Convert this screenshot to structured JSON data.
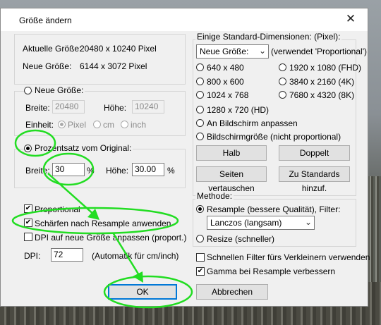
{
  "window": {
    "title": "Größe ändern",
    "close_symbol": "✕"
  },
  "info": {
    "current_label": "Aktuelle Größe:",
    "current_value": "20480  x  10240  Pixel",
    "new_label": "Neue Größe:",
    "new_value": "6144  x  3072  Pixel"
  },
  "new_size": {
    "radio_label": "Neue Größe:",
    "width_label": "Breite:",
    "width_value": "20480",
    "height_label": "Höhe:",
    "height_value": "10240",
    "unit_label": "Einheit:",
    "unit_pixel": "Pixel",
    "unit_cm": "cm",
    "unit_inch": "inch"
  },
  "percent": {
    "radio_label": "Prozentsatz vom Original:",
    "width_label": "Breite:",
    "width_value": "30",
    "width_unit": "%",
    "height_label": "Höhe:",
    "height_value": "30.00",
    "height_unit": "%"
  },
  "options": {
    "proportional": "Proportional",
    "sharpen": "Schärfen nach Resample anwenden",
    "dpi_apply": "DPI auf neue Größe anpassen (proport.)",
    "dpi_label": "DPI:",
    "dpi_value": "72",
    "dpi_note": "(Automatik für cm/inch)"
  },
  "buttons": {
    "ok": "OK",
    "cancel": "Abbrechen"
  },
  "standard": {
    "group_title": "Einige Standard-Dimensionen: (Pixel):",
    "select_value": "Neue Größe:",
    "select_note": "(verwendet 'Proportional')",
    "r640": "640 x 480",
    "r1920": "1920 x 1080 (FHD)",
    "r800": "800 x 600",
    "r3840": "3840 x 2160 (4K)",
    "r1024": "1024 x 768",
    "r7680": "7680 x 4320 (8K)",
    "r1280": "1280 x 720  (HD)",
    "fit_screen": "An Bildschirm anpassen",
    "screen_size": "Bildschirmgröße (nicht proportional)",
    "half": "Halb",
    "double": "Doppelt",
    "swap": "Seiten vertauschen",
    "add_std": "Zu Standards hinzuf."
  },
  "method": {
    "group_title": "Methode:",
    "resample": "Resample (bessere Qualität), Filter:",
    "filter_value": "Lanczos (langsam)",
    "resize": "Resize (schneller)",
    "fast_filter": "Schnellen Filter fürs Verkleinern verwenden",
    "gamma": "Gamma bei Resample verbessern"
  },
  "colors": {
    "annotation": "#22dd22",
    "focus_blue": "#0078d7"
  }
}
